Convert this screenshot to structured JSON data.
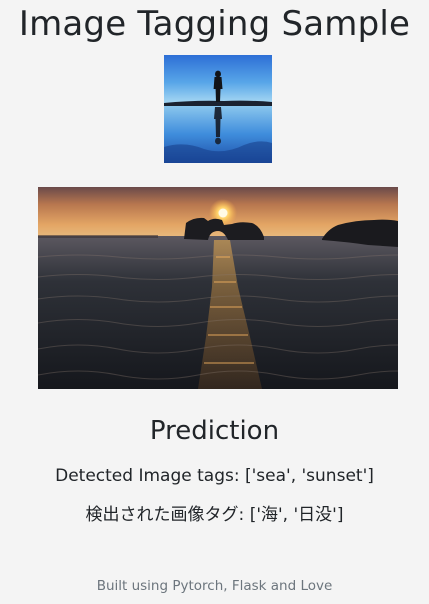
{
  "page": {
    "title": "Image Tagging Sample"
  },
  "images": {
    "thumbnail": {
      "alt": "Uploaded image thumbnail",
      "subject": "silhouette reflected on water"
    },
    "main": {
      "alt": "Uploaded image",
      "subject": "sunset over the sea"
    }
  },
  "prediction": {
    "heading": "Prediction",
    "tags_en_label": "Detected Image tags:",
    "tags_en_value": "['sea', 'sunset']",
    "tags_ja_label": "検出された画像タグ:",
    "tags_ja_value": "['海', '日没']"
  },
  "footer": {
    "text": "Built using Pytorch, Flask and Love"
  },
  "colors": {
    "background": "#f4f4f4",
    "text": "#212529",
    "muted": "#6c757d"
  }
}
